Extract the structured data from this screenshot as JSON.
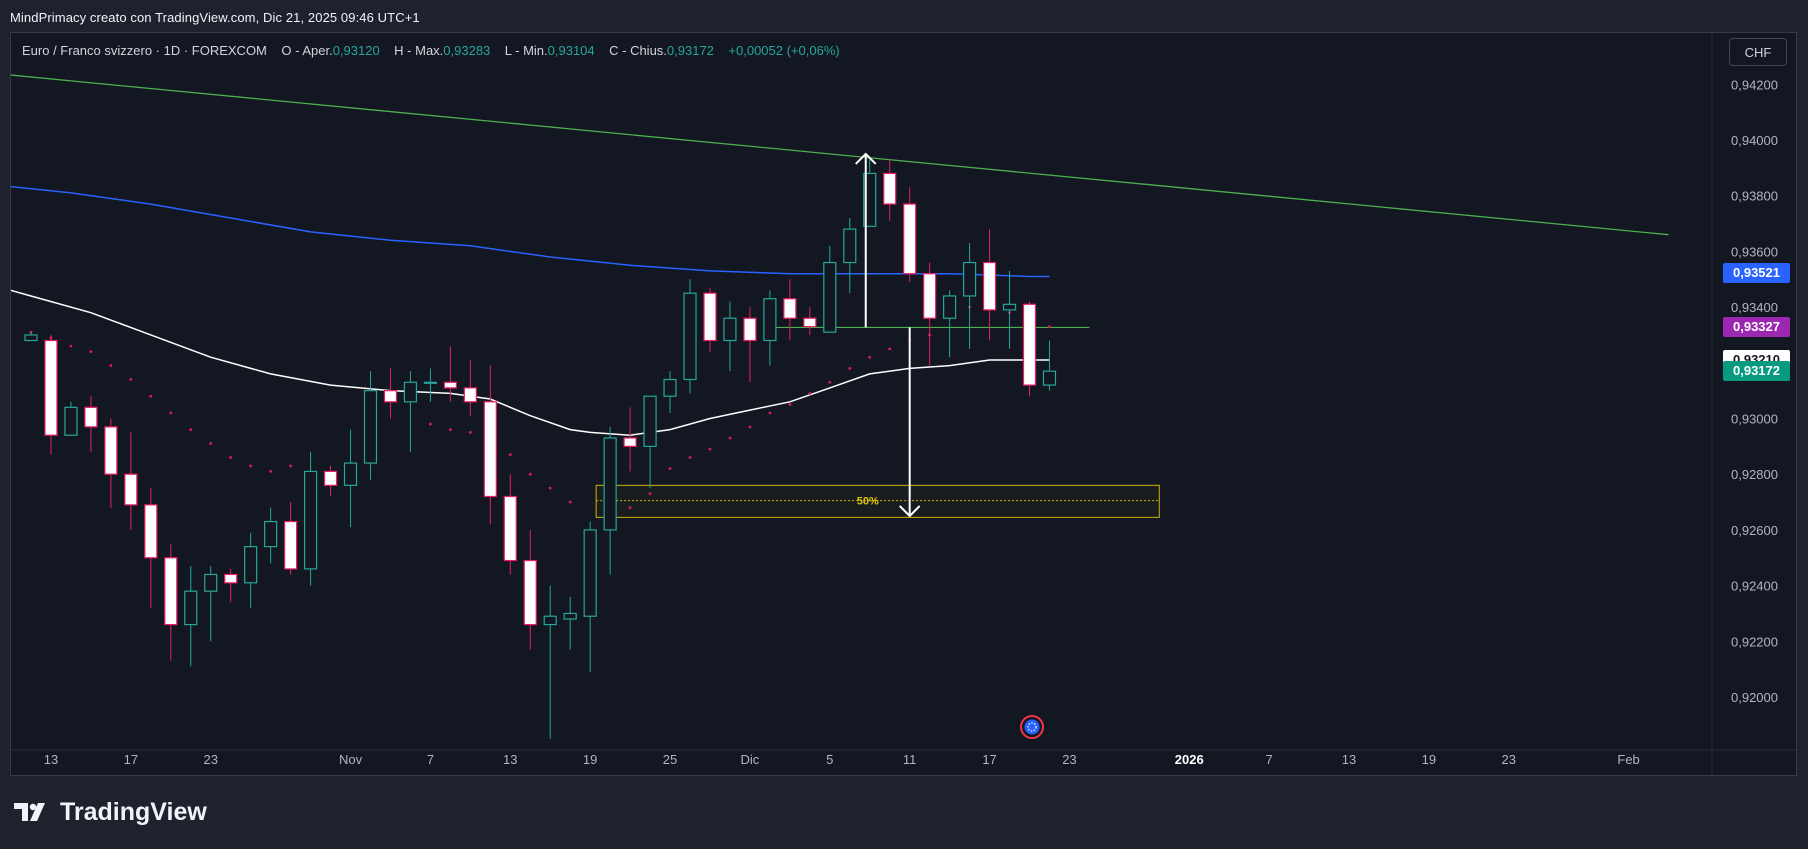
{
  "header": {
    "caption": "MindPrimacy creato con TradingView.com, Dic 21, 2025 09:46 UTC+1"
  },
  "legend": {
    "symbol": "Euro / Franco svizzero · 1D · FOREXCOM",
    "open_label": "O - Aper.",
    "open": "0,93120",
    "high_label": "H - Max.",
    "high": "0,93283",
    "low_label": "L - Min.",
    "low": "0,93104",
    "close_label": "C - Chius.",
    "close": "0,93172",
    "change": "+0,00052 (+0,06%)"
  },
  "currency_button": "CHF",
  "price_badges": [
    {
      "label": "0,93521",
      "value": 0.93521,
      "bg": "#2962ff",
      "fg": "#ffffff"
    },
    {
      "label": "0,93327",
      "value": 0.93327,
      "bg": "#9c27b0",
      "fg": "#ffffff"
    },
    {
      "label": "0,93210",
      "value": 0.9321,
      "bg": "#ffffff",
      "fg": "#131722"
    },
    {
      "label": "0,93172",
      "value": 0.93172,
      "bg": "#089981",
      "fg": "#ffffff"
    }
  ],
  "brand": {
    "name": "TradingView"
  },
  "colors": {
    "up": "#26a69a",
    "down": "#e91e63",
    "ma_long": "#2962ff",
    "ma_short": "#ffffff",
    "trendline": "#4caf50",
    "zone": "#c9b400",
    "psar": "#d81b60"
  },
  "chart_data": {
    "type": "candlestick",
    "ylim": [
      0.9183,
      0.9433
    ],
    "y_ticks": [
      {
        "label": "0,94200",
        "value": 0.942
      },
      {
        "label": "0,94000",
        "value": 0.94
      },
      {
        "label": "0,93800",
        "value": 0.938
      },
      {
        "label": "0,93600",
        "value": 0.936
      },
      {
        "label": "0,93400",
        "value": 0.934
      },
      {
        "label": "0,93200",
        "value": 0.932
      },
      {
        "label": "0,93000",
        "value": 0.93
      },
      {
        "label": "0,92800",
        "value": 0.928
      },
      {
        "label": "0,92600",
        "value": 0.926
      },
      {
        "label": "0,92400",
        "value": 0.924
      },
      {
        "label": "0,92200",
        "value": 0.922
      },
      {
        "label": "0,92000",
        "value": 0.92
      }
    ],
    "x_ticks": [
      {
        "label": "13",
        "bar": 1
      },
      {
        "label": "17",
        "bar": 5
      },
      {
        "label": "23",
        "bar": 9
      },
      {
        "label": "Nov",
        "bar": 16
      },
      {
        "label": "7",
        "bar": 20
      },
      {
        "label": "13",
        "bar": 24
      },
      {
        "label": "19",
        "bar": 28
      },
      {
        "label": "25",
        "bar": 32
      },
      {
        "label": "Dic",
        "bar": 36
      },
      {
        "label": "5",
        "bar": 40
      },
      {
        "label": "11",
        "bar": 44
      },
      {
        "label": "17",
        "bar": 48
      },
      {
        "label": "23",
        "bar": 52
      },
      {
        "label": "2026",
        "bar": 58,
        "bold": true
      },
      {
        "label": "7",
        "bar": 62
      },
      {
        "label": "13",
        "bar": 66
      },
      {
        "label": "19",
        "bar": 70
      },
      {
        "label": "23",
        "bar": 74
      },
      {
        "label": "Feb",
        "bar": 80
      }
    ],
    "candles": [
      {
        "o": 0.9328,
        "h": 0.9331,
        "l": 0.9328,
        "c": 0.933
      },
      {
        "o": 0.9328,
        "h": 0.933,
        "l": 0.9287,
        "c": 0.9294
      },
      {
        "o": 0.9294,
        "h": 0.9306,
        "l": 0.9294,
        "c": 0.9304
      },
      {
        "o": 0.9304,
        "h": 0.9308,
        "l": 0.9288,
        "c": 0.9297
      },
      {
        "o": 0.9297,
        "h": 0.93,
        "l": 0.9268,
        "c": 0.928
      },
      {
        "o": 0.928,
        "h": 0.9295,
        "l": 0.926,
        "c": 0.9269
      },
      {
        "o": 0.9269,
        "h": 0.9275,
        "l": 0.9232,
        "c": 0.925
      },
      {
        "o": 0.925,
        "h": 0.9255,
        "l": 0.9213,
        "c": 0.9226
      },
      {
        "o": 0.9226,
        "h": 0.9247,
        "l": 0.9211,
        "c": 0.9238
      },
      {
        "o": 0.9238,
        "h": 0.9247,
        "l": 0.922,
        "c": 0.9244
      },
      {
        "o": 0.9244,
        "h": 0.9246,
        "l": 0.9234,
        "c": 0.9241
      },
      {
        "o": 0.9241,
        "h": 0.9259,
        "l": 0.9232,
        "c": 0.9254
      },
      {
        "o": 0.9254,
        "h": 0.9268,
        "l": 0.9248,
        "c": 0.9263
      },
      {
        "o": 0.9263,
        "h": 0.927,
        "l": 0.9244,
        "c": 0.9246
      },
      {
        "o": 0.9246,
        "h": 0.9288,
        "l": 0.924,
        "c": 0.9281
      },
      {
        "o": 0.9281,
        "h": 0.9283,
        "l": 0.9272,
        "c": 0.9276
      },
      {
        "o": 0.9276,
        "h": 0.9296,
        "l": 0.9261,
        "c": 0.9284
      },
      {
        "o": 0.9284,
        "h": 0.9317,
        "l": 0.9278,
        "c": 0.931
      },
      {
        "o": 0.931,
        "h": 0.9318,
        "l": 0.93,
        "c": 0.9306
      },
      {
        "o": 0.9306,
        "h": 0.9317,
        "l": 0.9288,
        "c": 0.9313
      },
      {
        "o": 0.9313,
        "h": 0.9318,
        "l": 0.9306,
        "c": 0.9313
      },
      {
        "o": 0.9313,
        "h": 0.9326,
        "l": 0.9306,
        "c": 0.9311
      },
      {
        "o": 0.9311,
        "h": 0.9321,
        "l": 0.9301,
        "c": 0.9306
      },
      {
        "o": 0.9306,
        "h": 0.9319,
        "l": 0.9262,
        "c": 0.9272
      },
      {
        "o": 0.9272,
        "h": 0.928,
        "l": 0.9244,
        "c": 0.9249
      },
      {
        "o": 0.9249,
        "h": 0.926,
        "l": 0.9217,
        "c": 0.9226
      },
      {
        "o": 0.9226,
        "h": 0.924,
        "l": 0.9185,
        "c": 0.9229
      },
      {
        "o": 0.9228,
        "h": 0.9236,
        "l": 0.9217,
        "c": 0.923
      },
      {
        "o": 0.9229,
        "h": 0.9263,
        "l": 0.9209,
        "c": 0.926
      },
      {
        "o": 0.926,
        "h": 0.9297,
        "l": 0.9244,
        "c": 0.9293
      },
      {
        "o": 0.9293,
        "h": 0.9304,
        "l": 0.9281,
        "c": 0.929
      },
      {
        "o": 0.929,
        "h": 0.9308,
        "l": 0.9275,
        "c": 0.9308
      },
      {
        "o": 0.9308,
        "h": 0.9317,
        "l": 0.9302,
        "c": 0.9314
      },
      {
        "o": 0.9314,
        "h": 0.935,
        "l": 0.9309,
        "c": 0.9345
      },
      {
        "o": 0.9345,
        "h": 0.9347,
        "l": 0.9324,
        "c": 0.9328
      },
      {
        "o": 0.9328,
        "h": 0.9342,
        "l": 0.9317,
        "c": 0.9336
      },
      {
        "o": 0.9336,
        "h": 0.934,
        "l": 0.9313,
        "c": 0.9328
      },
      {
        "o": 0.9328,
        "h": 0.9346,
        "l": 0.9319,
        "c": 0.9343
      },
      {
        "o": 0.9343,
        "h": 0.935,
        "l": 0.9328,
        "c": 0.9336
      },
      {
        "o": 0.9336,
        "h": 0.934,
        "l": 0.933,
        "c": 0.9333
      },
      {
        "o": 0.9331,
        "h": 0.9362,
        "l": 0.9331,
        "c": 0.9356
      },
      {
        "o": 0.9356,
        "h": 0.9372,
        "l": 0.9345,
        "c": 0.9368
      },
      {
        "o": 0.9369,
        "h": 0.9394,
        "l": 0.9369,
        "c": 0.9388
      },
      {
        "o": 0.9388,
        "h": 0.9393,
        "l": 0.9371,
        "c": 0.9377
      },
      {
        "o": 0.9377,
        "h": 0.9383,
        "l": 0.9349,
        "c": 0.9352
      },
      {
        "o": 0.9352,
        "h": 0.9356,
        "l": 0.9319,
        "c": 0.9336
      },
      {
        "o": 0.9336,
        "h": 0.9346,
        "l": 0.9322,
        "c": 0.9344
      },
      {
        "o": 0.9344,
        "h": 0.9363,
        "l": 0.9325,
        "c": 0.9356
      },
      {
        "o": 0.9356,
        "h": 0.9368,
        "l": 0.9328,
        "c": 0.9339
      },
      {
        "o": 0.9339,
        "h": 0.9353,
        "l": 0.9325,
        "c": 0.9341
      },
      {
        "o": 0.9341,
        "h": 0.9342,
        "l": 0.9308,
        "c": 0.9312
      },
      {
        "o": 0.9312,
        "h": 0.9328,
        "l": 0.931,
        "c": 0.9317
      }
    ],
    "ma_long": {
      "name": "",
      "points": [
        [
          -2,
          0.9384
        ],
        [
          2,
          0.9381
        ],
        [
          6,
          0.9377
        ],
        [
          10,
          0.9372
        ],
        [
          14,
          0.9367
        ],
        [
          18,
          0.9364
        ],
        [
          22,
          0.9362
        ],
        [
          26,
          0.9358
        ],
        [
          30,
          0.9355
        ],
        [
          34,
          0.9353
        ],
        [
          38,
          0.9352
        ],
        [
          42,
          0.9352
        ],
        [
          46,
          0.9352
        ],
        [
          50,
          0.9351
        ],
        [
          51,
          0.9351
        ]
      ]
    },
    "ma_short": {
      "name": "",
      "points": [
        [
          -2,
          0.9348
        ],
        [
          0,
          0.9344
        ],
        [
          3,
          0.9338
        ],
        [
          6,
          0.933
        ],
        [
          9,
          0.9322
        ],
        [
          12,
          0.9316
        ],
        [
          15,
          0.9312
        ],
        [
          18,
          0.931
        ],
        [
          21,
          0.9309
        ],
        [
          23,
          0.9307
        ],
        [
          25,
          0.9301
        ],
        [
          27,
          0.9296
        ],
        [
          28,
          0.9295
        ],
        [
          30,
          0.9294
        ],
        [
          32,
          0.9296
        ],
        [
          34,
          0.93
        ],
        [
          36,
          0.9303
        ],
        [
          38,
          0.9306
        ],
        [
          40,
          0.9311
        ],
        [
          42,
          0.9316
        ],
        [
          44,
          0.9318
        ],
        [
          46,
          0.9319
        ],
        [
          48,
          0.9321
        ],
        [
          50,
          0.9321
        ],
        [
          51,
          0.9321
        ]
      ]
    },
    "psar": [
      {
        "bar": 0,
        "v": 0.9331
      },
      {
        "bar": 1,
        "v": 0.9329
      },
      {
        "bar": 2,
        "v": 0.9326
      },
      {
        "bar": 3,
        "v": 0.9324
      },
      {
        "bar": 4,
        "v": 0.9319
      },
      {
        "bar": 5,
        "v": 0.9314
      },
      {
        "bar": 6,
        "v": 0.9308
      },
      {
        "bar": 7,
        "v": 0.9302
      },
      {
        "bar": 8,
        "v": 0.9296
      },
      {
        "bar": 9,
        "v": 0.9291
      },
      {
        "bar": 10,
        "v": 0.9286
      },
      {
        "bar": 11,
        "v": 0.9283
      },
      {
        "bar": 12,
        "v": 0.9281
      },
      {
        "bar": 13,
        "v": 0.9283
      },
      {
        "bar": 20,
        "v": 0.9298
      },
      {
        "bar": 21,
        "v": 0.9296
      },
      {
        "bar": 22,
        "v": 0.9295
      },
      {
        "bar": 23,
        "v": 0.9292
      },
      {
        "bar": 24,
        "v": 0.9287
      },
      {
        "bar": 25,
        "v": 0.928
      },
      {
        "bar": 26,
        "v": 0.9275
      },
      {
        "bar": 27,
        "v": 0.927
      },
      {
        "bar": 30,
        "v": 0.9268
      },
      {
        "bar": 31,
        "v": 0.9273
      },
      {
        "bar": 32,
        "v": 0.9282
      },
      {
        "bar": 33,
        "v": 0.9286
      },
      {
        "bar": 34,
        "v": 0.9289
      },
      {
        "bar": 35,
        "v": 0.9293
      },
      {
        "bar": 36,
        "v": 0.9297
      },
      {
        "bar": 37,
        "v": 0.9302
      },
      {
        "bar": 38,
        "v": 0.9305
      },
      {
        "bar": 39,
        "v": 0.9309
      },
      {
        "bar": 40,
        "v": 0.9313
      },
      {
        "bar": 41,
        "v": 0.9318
      },
      {
        "bar": 42,
        "v": 0.9322
      },
      {
        "bar": 43,
        "v": 0.9325
      },
      {
        "bar": 44,
        "v": 0.9328
      },
      {
        "bar": 45,
        "v": 0.933
      },
      {
        "bar": 46,
        "v": 0.9338
      },
      {
        "bar": 47,
        "v": 0.934
      },
      {
        "bar": 48,
        "v": 0.9342
      },
      {
        "bar": 49,
        "v": 0.9338
      },
      {
        "bar": 50,
        "v": 0.9334
      },
      {
        "bar": 51,
        "v": 0.9333
      }
    ],
    "trendline": {
      "start": [
        -2,
        0.9424
      ],
      "end": [
        82,
        0.9366
      ]
    },
    "support_line": {
      "start": [
        37,
        0.93327
      ],
      "end": [
        53,
        0.93327
      ]
    },
    "measure_up": {
      "bar": 41.8,
      "from": 0.93327,
      "to": 0.9395
    },
    "measure_down": {
      "bar": 44.0,
      "from": 0.93327,
      "to": 0.9265
    },
    "zone": {
      "bar_start": 28.3,
      "bar_end": 56.5,
      "top": 0.9276,
      "bottom": 0.92645,
      "mid": 0.92705,
      "label": "50%"
    }
  }
}
